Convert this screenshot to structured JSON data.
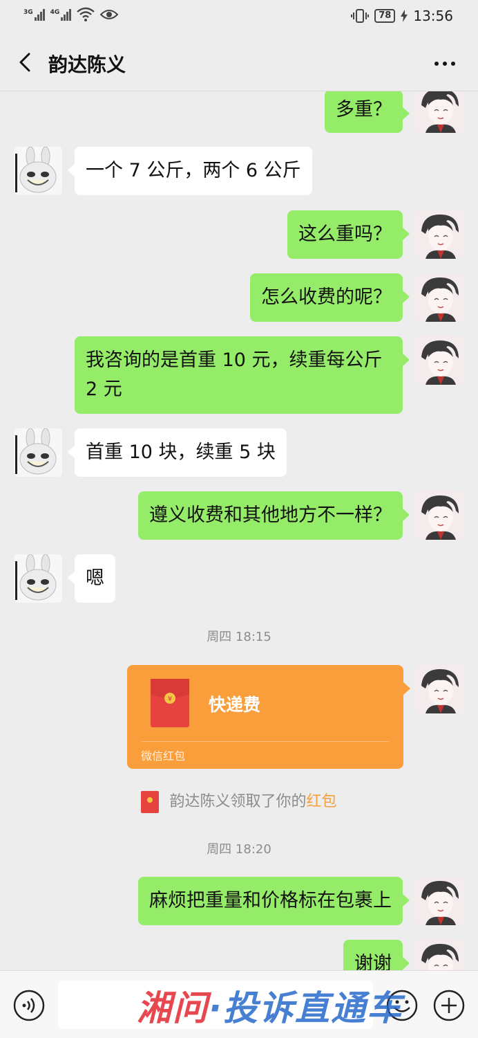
{
  "status_bar": {
    "signal1_label": "3G",
    "signal2_label": "4G",
    "battery": "78",
    "time": "13:56",
    "icons": [
      "signal-icon",
      "wifi-icon",
      "eye-icon",
      "vibrate-icon",
      "battery-icon",
      "charging-icon"
    ]
  },
  "header": {
    "title": "韵达陈义",
    "back_icon": "chevron-left-icon",
    "more_icon": "more-icon"
  },
  "messages": [
    {
      "side": "out",
      "text": "多重？"
    },
    {
      "side": "in",
      "text": "一个 7 公斤，两个 6 公斤"
    },
    {
      "side": "out",
      "text": "这么重吗？"
    },
    {
      "side": "out",
      "text": "怎么收费的呢？"
    },
    {
      "side": "out",
      "text_line1": "我咨询的是首重 10 元，续重每公斤",
      "text_line2": "2 元"
    },
    {
      "side": "in",
      "text": "首重 10 块，续重 5 块"
    },
    {
      "side": "out",
      "text": "遵义收费和其他地方不一样？"
    },
    {
      "side": "in",
      "text": "嗯"
    },
    {
      "side": "out",
      "text": "麻烦把重量和价格标在包裹上"
    },
    {
      "side": "out",
      "text": "谢谢"
    }
  ],
  "timestamps": [
    "周四 18:15",
    "周四 18:20"
  ],
  "red_packet": {
    "title": "快递费",
    "label": "微信红包",
    "color": "#fa9d3b"
  },
  "notice": {
    "text": "韵达陈义领取了你的",
    "highlight": "红包"
  },
  "bottom_bar": {
    "icons": [
      "voice-icon",
      "emoji-icon",
      "plus-icon"
    ],
    "input_placeholder": ""
  },
  "watermark": {
    "part1": "湘问",
    "part2": "·投诉直通车"
  },
  "colors": {
    "outgoing_bubble": "#95ec69",
    "incoming_bubble": "#ffffff",
    "background": "#ededed"
  }
}
